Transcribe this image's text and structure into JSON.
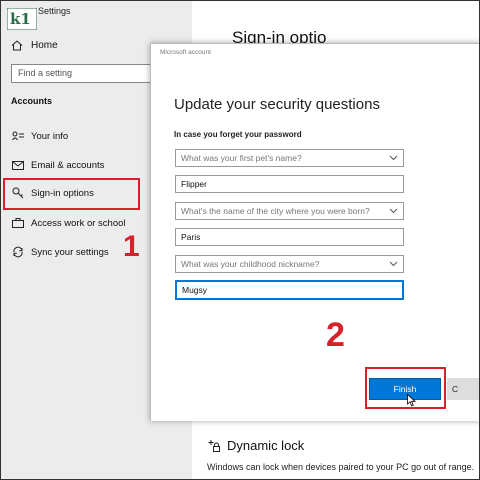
{
  "window": {
    "title": "Settings"
  },
  "sidebar": {
    "home_label": "Home",
    "search_placeholder": "Find a setting",
    "section_heading": "Accounts",
    "items": [
      {
        "label": "Your info",
        "icon": "person-card-icon"
      },
      {
        "label": "Email & accounts",
        "icon": "mail-icon"
      },
      {
        "label": "Sign-in options",
        "icon": "key-icon",
        "highlighted": true
      },
      {
        "label": "Access work or school",
        "icon": "briefcase-icon"
      },
      {
        "label": "Sync your settings",
        "icon": "sync-icon"
      }
    ]
  },
  "annotations": {
    "step1": "1",
    "step2": "2",
    "highlight_color": "#d6202a"
  },
  "main": {
    "partial_title": "Sign-in optio",
    "dynamic_lock_title": "Dynamic lock",
    "dynamic_lock_text": "Windows can lock when devices paired to your PC go out of range."
  },
  "dialog": {
    "window_title": "Microsoft account",
    "heading": "Update your security questions",
    "subheading": "In case you forget your password",
    "questions": [
      {
        "placeholder": "What was your first pet's name?",
        "answer": "Flipper"
      },
      {
        "placeholder": "What's the name of the city where you were born?",
        "answer": "Paris"
      },
      {
        "placeholder": "What was your childhood nickname?",
        "answer": "Mugsy"
      }
    ],
    "finish_label": "Finish",
    "cancel_label": "C",
    "accent": "#0078d7"
  }
}
